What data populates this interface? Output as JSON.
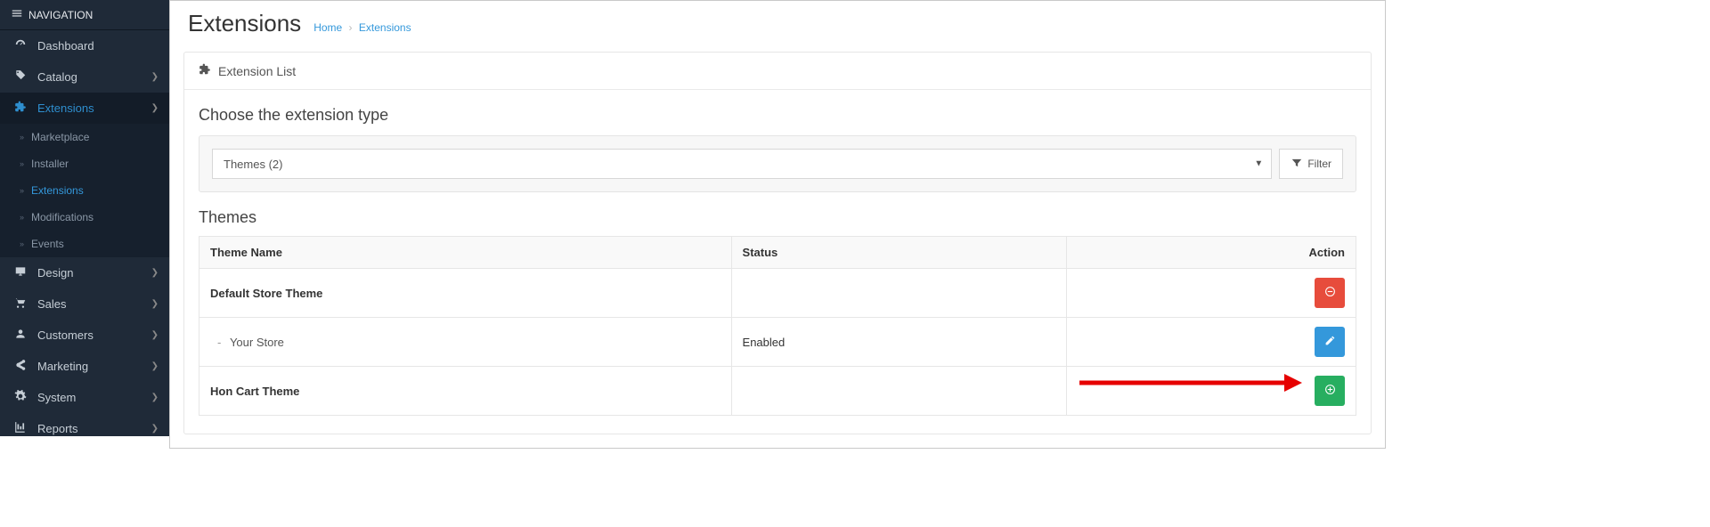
{
  "sidebar": {
    "header": "NAVIGATION",
    "items": [
      {
        "label": "Dashboard"
      },
      {
        "label": "Catalog"
      },
      {
        "label": "Extensions"
      },
      {
        "label": "Design"
      },
      {
        "label": "Sales"
      },
      {
        "label": "Customers"
      },
      {
        "label": "Marketing"
      },
      {
        "label": "System"
      },
      {
        "label": "Reports"
      }
    ],
    "extensions_sub": [
      {
        "label": "Marketplace"
      },
      {
        "label": "Installer"
      },
      {
        "label": "Extensions"
      },
      {
        "label": "Modifications"
      },
      {
        "label": "Events"
      }
    ]
  },
  "page": {
    "title": "Extensions",
    "breadcrumb_home": "Home",
    "breadcrumb_current": "Extensions"
  },
  "panel": {
    "heading": "Extension List",
    "choose_label": "Choose the extension type",
    "select_value": "Themes (2)",
    "filter_label": "Filter",
    "themes_heading": "Themes"
  },
  "table": {
    "cols": {
      "name": "Theme Name",
      "status": "Status",
      "action": "Action"
    },
    "rows": [
      {
        "name": "Default Store Theme",
        "status": "",
        "action": "uninstall",
        "bold": true
      },
      {
        "name": "Your Store",
        "status": "Enabled",
        "action": "edit",
        "sub": true
      },
      {
        "name": "Hon Cart Theme",
        "status": "",
        "action": "install",
        "bold": true
      }
    ]
  },
  "colors": {
    "accent": "#3498db",
    "danger": "#e74c3c",
    "success": "#27ae60"
  }
}
